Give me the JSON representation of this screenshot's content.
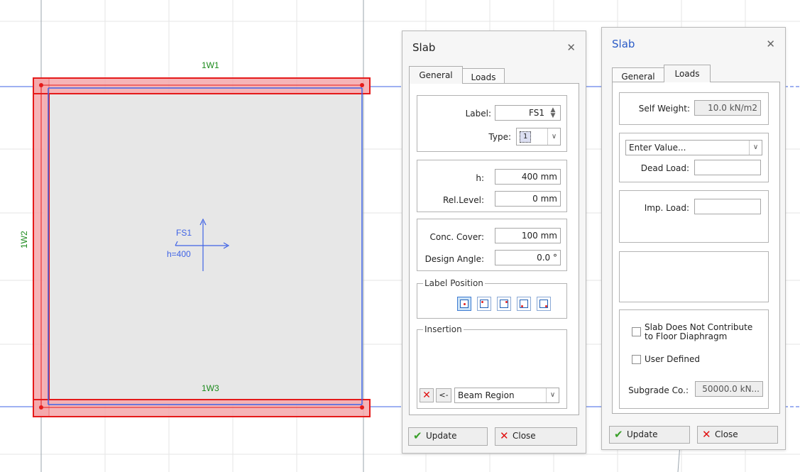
{
  "canvas": {
    "labels": {
      "top_wall": "1W1",
      "left_wall": "1W2",
      "bottom_wall": "1W3",
      "slab_label": "FS1",
      "slab_thickness": "h=400"
    },
    "colors": {
      "wall_stroke": "#e51a1a",
      "wall_fill": "#f4a7aa",
      "slab_fill": "#e7e7e7",
      "axis": "#3f63e6",
      "label_green": "#1b8a1b",
      "grid": "#e3e3e3"
    }
  },
  "general_dialog": {
    "title": "Slab",
    "close_icon": "close-icon",
    "tabs": [
      "General",
      "Loads"
    ],
    "active_tab": "General",
    "fields": {
      "label_label": "Label:",
      "label_value": "FS1",
      "type_label": "Type:",
      "type_value": "1",
      "h_label": "h:",
      "h_value": "400 mm",
      "rel_level_label": "Rel.Level:",
      "rel_level_value": "0 mm",
      "conc_cover_label": "Conc. Cover:",
      "conc_cover_value": "100 mm",
      "design_angle_label": "Design Angle:",
      "design_angle_value": "0.0 °"
    },
    "label_position": {
      "legend": "Label Position",
      "selected_index": 0
    },
    "insertion": {
      "legend": "Insertion",
      "mode_arrow": "<-",
      "mode_value": "Beam Region"
    },
    "buttons": {
      "update": "Update",
      "close": "Close"
    }
  },
  "loads_dialog": {
    "title": "Slab",
    "close_icon": "close-icon",
    "tabs": [
      "General",
      "Loads"
    ],
    "active_tab": "Loads",
    "fields": {
      "self_weight_label": "Self Weight:",
      "self_weight_value": "10.0 kN/m2",
      "enter_value_select": "Enter Value...",
      "dead_load_label": "Dead Load:",
      "dead_load_value": "",
      "imp_load_label": "Imp. Load:",
      "imp_load_value": "",
      "no_diaphragm_label": "Slab Does Not Contribute to Floor Diaphragm",
      "no_diaphragm_checked": false,
      "user_defined_label": "User Defined",
      "user_defined_checked": false,
      "subgrade_label": "Subgrade Co.:",
      "subgrade_value": "50000.0 kN..."
    },
    "buttons": {
      "update": "Update",
      "close": "Close"
    }
  }
}
